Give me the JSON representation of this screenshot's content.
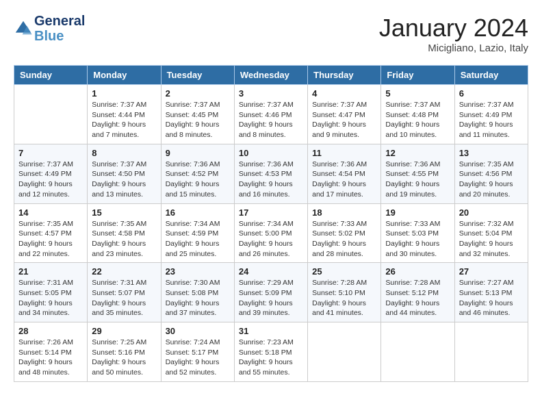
{
  "header": {
    "logo_line1": "General",
    "logo_line2": "Blue",
    "title": "January 2024",
    "subtitle": "Micigliano, Lazio, Italy"
  },
  "weekdays": [
    "Sunday",
    "Monday",
    "Tuesday",
    "Wednesday",
    "Thursday",
    "Friday",
    "Saturday"
  ],
  "weeks": [
    [
      {
        "num": "",
        "info": ""
      },
      {
        "num": "1",
        "info": "Sunrise: 7:37 AM\nSunset: 4:44 PM\nDaylight: 9 hours\nand 7 minutes."
      },
      {
        "num": "2",
        "info": "Sunrise: 7:37 AM\nSunset: 4:45 PM\nDaylight: 9 hours\nand 8 minutes."
      },
      {
        "num": "3",
        "info": "Sunrise: 7:37 AM\nSunset: 4:46 PM\nDaylight: 9 hours\nand 8 minutes."
      },
      {
        "num": "4",
        "info": "Sunrise: 7:37 AM\nSunset: 4:47 PM\nDaylight: 9 hours\nand 9 minutes."
      },
      {
        "num": "5",
        "info": "Sunrise: 7:37 AM\nSunset: 4:48 PM\nDaylight: 9 hours\nand 10 minutes."
      },
      {
        "num": "6",
        "info": "Sunrise: 7:37 AM\nSunset: 4:49 PM\nDaylight: 9 hours\nand 11 minutes."
      }
    ],
    [
      {
        "num": "7",
        "info": "Sunrise: 7:37 AM\nSunset: 4:49 PM\nDaylight: 9 hours\nand 12 minutes."
      },
      {
        "num": "8",
        "info": "Sunrise: 7:37 AM\nSunset: 4:50 PM\nDaylight: 9 hours\nand 13 minutes."
      },
      {
        "num": "9",
        "info": "Sunrise: 7:36 AM\nSunset: 4:52 PM\nDaylight: 9 hours\nand 15 minutes."
      },
      {
        "num": "10",
        "info": "Sunrise: 7:36 AM\nSunset: 4:53 PM\nDaylight: 9 hours\nand 16 minutes."
      },
      {
        "num": "11",
        "info": "Sunrise: 7:36 AM\nSunset: 4:54 PM\nDaylight: 9 hours\nand 17 minutes."
      },
      {
        "num": "12",
        "info": "Sunrise: 7:36 AM\nSunset: 4:55 PM\nDaylight: 9 hours\nand 19 minutes."
      },
      {
        "num": "13",
        "info": "Sunrise: 7:35 AM\nSunset: 4:56 PM\nDaylight: 9 hours\nand 20 minutes."
      }
    ],
    [
      {
        "num": "14",
        "info": "Sunrise: 7:35 AM\nSunset: 4:57 PM\nDaylight: 9 hours\nand 22 minutes."
      },
      {
        "num": "15",
        "info": "Sunrise: 7:35 AM\nSunset: 4:58 PM\nDaylight: 9 hours\nand 23 minutes."
      },
      {
        "num": "16",
        "info": "Sunrise: 7:34 AM\nSunset: 4:59 PM\nDaylight: 9 hours\nand 25 minutes."
      },
      {
        "num": "17",
        "info": "Sunrise: 7:34 AM\nSunset: 5:00 PM\nDaylight: 9 hours\nand 26 minutes."
      },
      {
        "num": "18",
        "info": "Sunrise: 7:33 AM\nSunset: 5:02 PM\nDaylight: 9 hours\nand 28 minutes."
      },
      {
        "num": "19",
        "info": "Sunrise: 7:33 AM\nSunset: 5:03 PM\nDaylight: 9 hours\nand 30 minutes."
      },
      {
        "num": "20",
        "info": "Sunrise: 7:32 AM\nSunset: 5:04 PM\nDaylight: 9 hours\nand 32 minutes."
      }
    ],
    [
      {
        "num": "21",
        "info": "Sunrise: 7:31 AM\nSunset: 5:05 PM\nDaylight: 9 hours\nand 34 minutes."
      },
      {
        "num": "22",
        "info": "Sunrise: 7:31 AM\nSunset: 5:07 PM\nDaylight: 9 hours\nand 35 minutes."
      },
      {
        "num": "23",
        "info": "Sunrise: 7:30 AM\nSunset: 5:08 PM\nDaylight: 9 hours\nand 37 minutes."
      },
      {
        "num": "24",
        "info": "Sunrise: 7:29 AM\nSunset: 5:09 PM\nDaylight: 9 hours\nand 39 minutes."
      },
      {
        "num": "25",
        "info": "Sunrise: 7:28 AM\nSunset: 5:10 PM\nDaylight: 9 hours\nand 41 minutes."
      },
      {
        "num": "26",
        "info": "Sunrise: 7:28 AM\nSunset: 5:12 PM\nDaylight: 9 hours\nand 44 minutes."
      },
      {
        "num": "27",
        "info": "Sunrise: 7:27 AM\nSunset: 5:13 PM\nDaylight: 9 hours\nand 46 minutes."
      }
    ],
    [
      {
        "num": "28",
        "info": "Sunrise: 7:26 AM\nSunset: 5:14 PM\nDaylight: 9 hours\nand 48 minutes."
      },
      {
        "num": "29",
        "info": "Sunrise: 7:25 AM\nSunset: 5:16 PM\nDaylight: 9 hours\nand 50 minutes."
      },
      {
        "num": "30",
        "info": "Sunrise: 7:24 AM\nSunset: 5:17 PM\nDaylight: 9 hours\nand 52 minutes."
      },
      {
        "num": "31",
        "info": "Sunrise: 7:23 AM\nSunset: 5:18 PM\nDaylight: 9 hours\nand 55 minutes."
      },
      {
        "num": "",
        "info": ""
      },
      {
        "num": "",
        "info": ""
      },
      {
        "num": "",
        "info": ""
      }
    ]
  ]
}
